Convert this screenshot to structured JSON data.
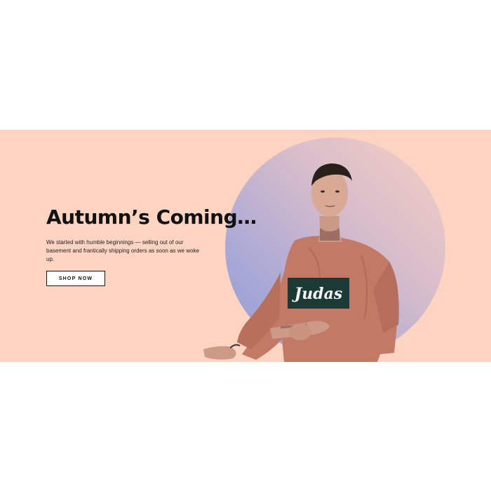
{
  "hero": {
    "title": "Autumn’s Coming…",
    "description": "We started with humble beginnings — selling out of our basement and frantically shipping orders as soon as we woke up.",
    "cta_label": "SHOP NOW",
    "sweater_print": "Judas"
  },
  "colors": {
    "banner_bg": "#fdd3c2",
    "circle_start": "#f6cfc3",
    "circle_end": "#8f9bd8",
    "sweater": "#c27a66",
    "text": "#111111"
  }
}
